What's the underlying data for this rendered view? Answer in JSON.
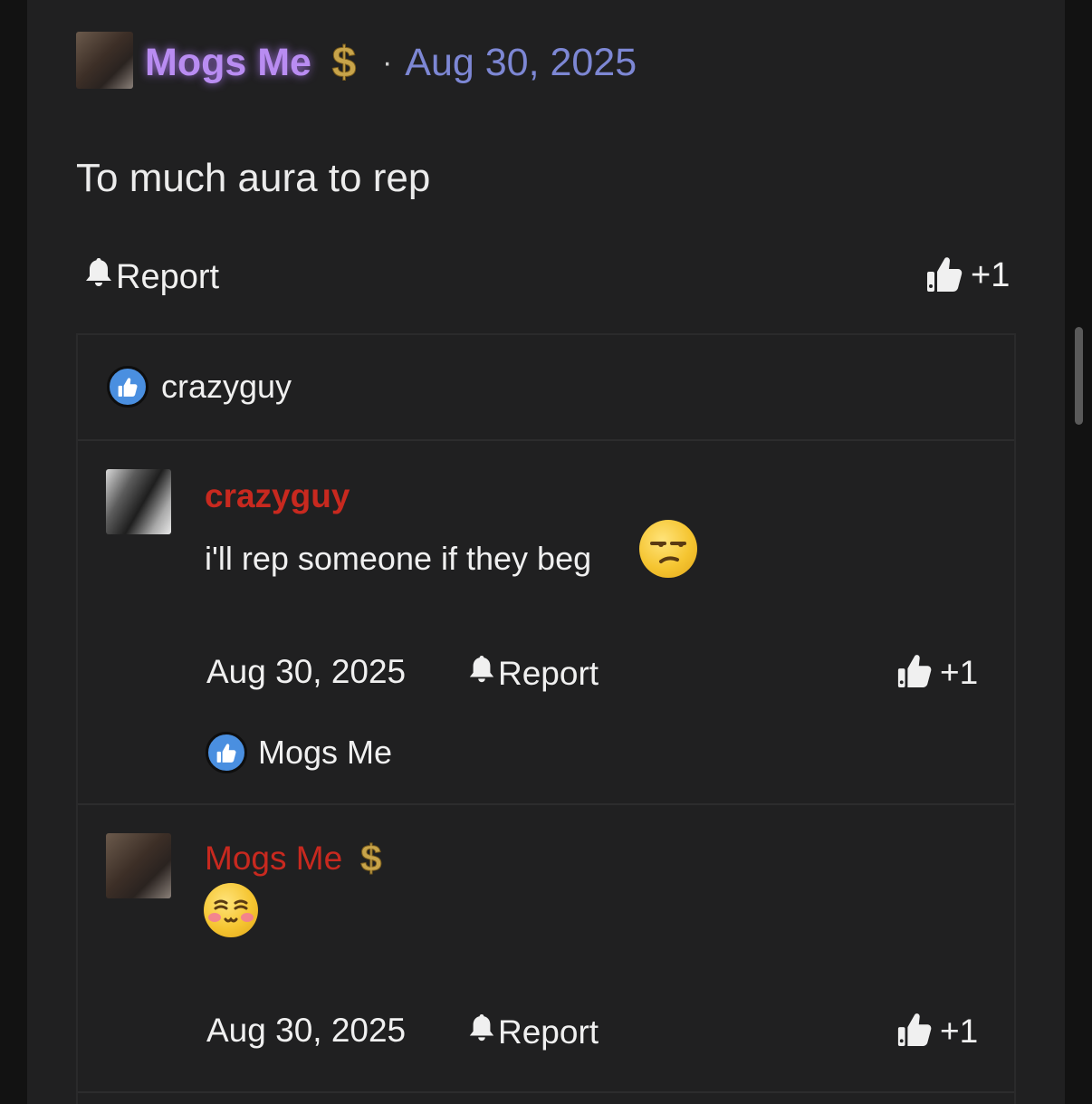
{
  "post": {
    "author": "Mogs Me",
    "badge_icon": "dollar-icon",
    "separator": "·",
    "date": "Aug 30, 2025",
    "text": "To much aura to rep",
    "report_label": "Report",
    "like_count": "+1"
  },
  "likes_panel": {
    "liker": "crazyguy"
  },
  "replies": [
    {
      "author": "crazyguy",
      "text": "i'll rep someone if they beg",
      "emoji": "unamused-face",
      "date": "Aug 30, 2025",
      "report_label": "Report",
      "like_count": "+1",
      "liked_by": "Mogs Me"
    },
    {
      "author": "Mogs Me",
      "badge_icon": "dollar-icon",
      "emoji": "blushing-content-face",
      "date": "Aug 30, 2025",
      "report_label": "Report",
      "like_count": "+1"
    }
  ],
  "colors": {
    "background": "#202021",
    "author_glow": "#b98cf2",
    "date_link": "#7d87d4",
    "reply_author": "#c8291f",
    "like_badge": "#4a8fe0"
  }
}
